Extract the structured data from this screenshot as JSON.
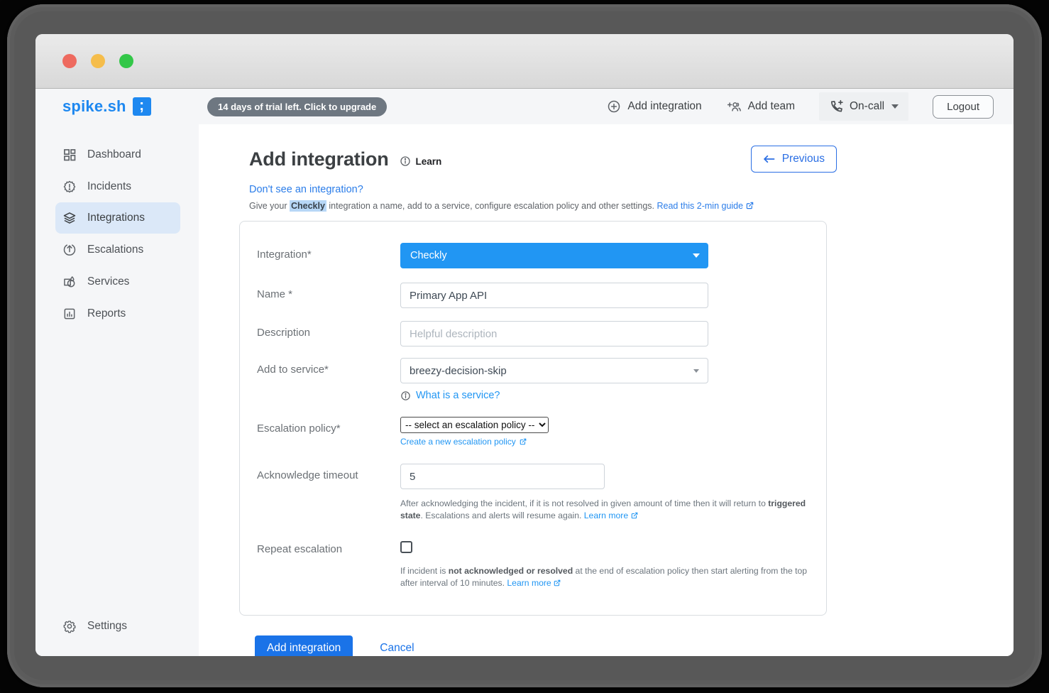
{
  "colors": {
    "accent_blue": "#2196f3",
    "button_blue": "#1a73e8",
    "link_blue": "#2b7de9",
    "sidebar_active_bg": "#dbe8f8",
    "topbar_bg": "#f5f6f8",
    "trial_pill_bg": "#6e7781",
    "highlight_selection": "#b7d7f6",
    "traffic_red": "#ee6a5f",
    "traffic_yellow": "#f5bd4b",
    "traffic_green": "#33c748"
  },
  "icons": {
    "logo-mark": "; on blue square",
    "circle-plus-icon": "outlined circle with plus",
    "person-plus-icon": "two people with plus",
    "phone-plus-icon": "phone handset with plus",
    "dashboard-grid-icon": "four tiles grid",
    "incidents-badge-icon": "seal badge with exclamation",
    "integrations-layers-icon": "stacked layers",
    "escalations-arrow-icon": "circled up arrow",
    "services-shapes-icon": "square circle drop shapes",
    "reports-chart-icon": "bar chart in square",
    "gear-icon": "settings gear",
    "info-icon": "circled i",
    "external-link-icon": "box with outgoing arrow",
    "arrow-left-icon": "left arrow",
    "chevron-down-icon": "down caret"
  },
  "topbar": {
    "logo_text": "spike.sh",
    "logo_mark": ";",
    "trial_badge": "14 days of trial left. Click to upgrade",
    "add_integration_label": "Add integration",
    "add_team_label": "Add team",
    "on_call_label": "On-call",
    "logout_label": "Logout"
  },
  "sidebar": {
    "items": [
      {
        "label": "Dashboard",
        "active": false
      },
      {
        "label": "Incidents",
        "active": false
      },
      {
        "label": "Integrations",
        "active": true
      },
      {
        "label": "Escalations",
        "active": false
      },
      {
        "label": "Services",
        "active": false
      },
      {
        "label": "Reports",
        "active": false
      }
    ],
    "settings_label": "Settings"
  },
  "main": {
    "title": "Add integration",
    "learn_label": "Learn",
    "previous_label": "Previous",
    "dont_see_link": "Don't see an integration?",
    "intro": {
      "prefix": "Give your ",
      "highlight": "Checkly",
      "suffix": " integration a name, add to a service, configure escalation policy and other settings. ",
      "link": "Read this 2-min guide"
    },
    "form": {
      "integration_label": "Integration*",
      "integration_value": "Checkly",
      "name_label": "Name *",
      "name_value": "Primary App API",
      "description_label": "Description",
      "description_placeholder": "Helpful description",
      "service_label": "Add to service*",
      "service_value": "breezy-decision-skip",
      "service_help": "What is a service?",
      "policy_label": "Escalation policy*",
      "policy_value": "-- select an escalation policy --",
      "policy_link": "Create a new escalation policy",
      "ack_label": "Acknowledge timeout",
      "ack_value": "5",
      "ack_help": {
        "part1": "After acknowledging the incident, if it is not resolved in given amount of time then it will return to ",
        "bold": "triggered state",
        "part2": ". Escalations and alerts will resume again. ",
        "link": "Learn more"
      },
      "repeat_label": "Repeat escalation",
      "repeat_help": {
        "part1": "If incident is ",
        "bold": "not acknowledged or resolved",
        "part2": " at the end of escalation policy then start alerting from the top after interval of 10 minutes. ",
        "link": "Learn more"
      },
      "submit_label": "Add integration",
      "cancel_label": "Cancel"
    }
  }
}
